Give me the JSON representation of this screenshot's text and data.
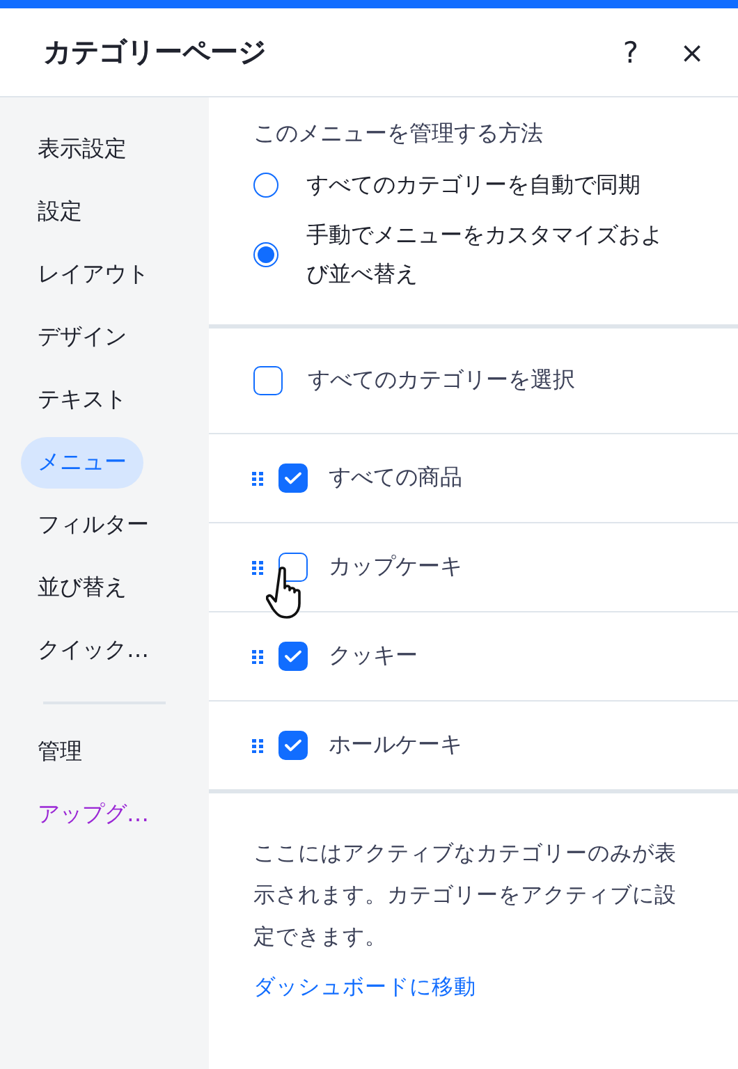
{
  "window": {
    "title": "カテゴリーページ",
    "help": "?",
    "close": "×"
  },
  "sidebar": {
    "items": [
      {
        "label": "表示設定",
        "selected": false
      },
      {
        "label": "設定",
        "selected": false
      },
      {
        "label": "レイアウト",
        "selected": false
      },
      {
        "label": "デザイン",
        "selected": false
      },
      {
        "label": "テキスト",
        "selected": false
      },
      {
        "label": "メニュー",
        "selected": true
      },
      {
        "label": "フィルター",
        "selected": false
      },
      {
        "label": "並び替え",
        "selected": false
      },
      {
        "label": "クイック…",
        "selected": false
      }
    ],
    "bottom_items": [
      {
        "label": "管理",
        "kind": "plain"
      },
      {
        "label": "アップグ…",
        "kind": "upgrade"
      }
    ]
  },
  "manage": {
    "title": "このメニューを管理する方法",
    "options": [
      {
        "label": "すべてのカテゴリーを自動で同期",
        "selected": false
      },
      {
        "label": "手動でメニューをカスタマイズおよび並べ替え",
        "selected": true
      }
    ]
  },
  "select_all": {
    "label": "すべてのカテゴリーを選択",
    "checked": false
  },
  "categories": [
    {
      "label": "すべての商品",
      "checked": true
    },
    {
      "label": "カップケーキ",
      "checked": false
    },
    {
      "label": "クッキー",
      "checked": true
    },
    {
      "label": "ホールケーキ",
      "checked": true
    }
  ],
  "footer": {
    "note": "ここにはアクティブなカテゴリーのみが表示されます。カテゴリーをアクティブに設定できます。",
    "link": "ダッシュボードに移動"
  }
}
